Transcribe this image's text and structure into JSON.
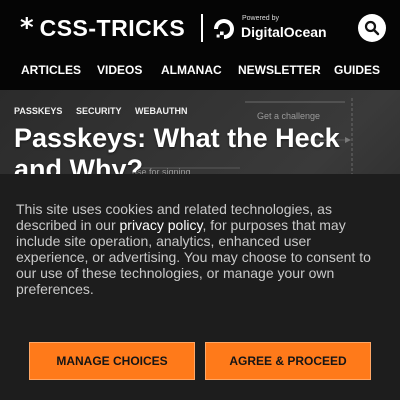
{
  "header": {
    "logo_star": "*",
    "logo_text": "CSS-TRICKS",
    "sponsor_powered": "Powered by",
    "sponsor_name": "DigitalOcean",
    "search_icon": "search-icon",
    "nav": [
      "ARTICLES",
      "VIDEOS",
      "ALMANAC",
      "NEWSLETTER",
      "GUIDES"
    ]
  },
  "hero": {
    "tags": [
      "PASSKEYS",
      "SECURITY",
      "WEBAUTHN"
    ],
    "title": "Passkeys: What the Heck and Why?",
    "diagram_labels": [
      "Get a challenge",
      "use for signing"
    ]
  },
  "consent": {
    "text_before": "This site uses cookies and related technologies, as described in our ",
    "link": "privacy policy",
    "text_after": ", for purposes that may include site operation, analytics, enhanced user experience, or advertising. You may choose to consent to our use of these technologies, or manage your own preferences.",
    "manage_label": "MANAGE CHOICES",
    "agree_label": "AGREE & PROCEED"
  },
  "colors": {
    "header_bg": "#050505",
    "consent_bg": "#1d1d1d",
    "button_accent": "#ff7a1a"
  }
}
